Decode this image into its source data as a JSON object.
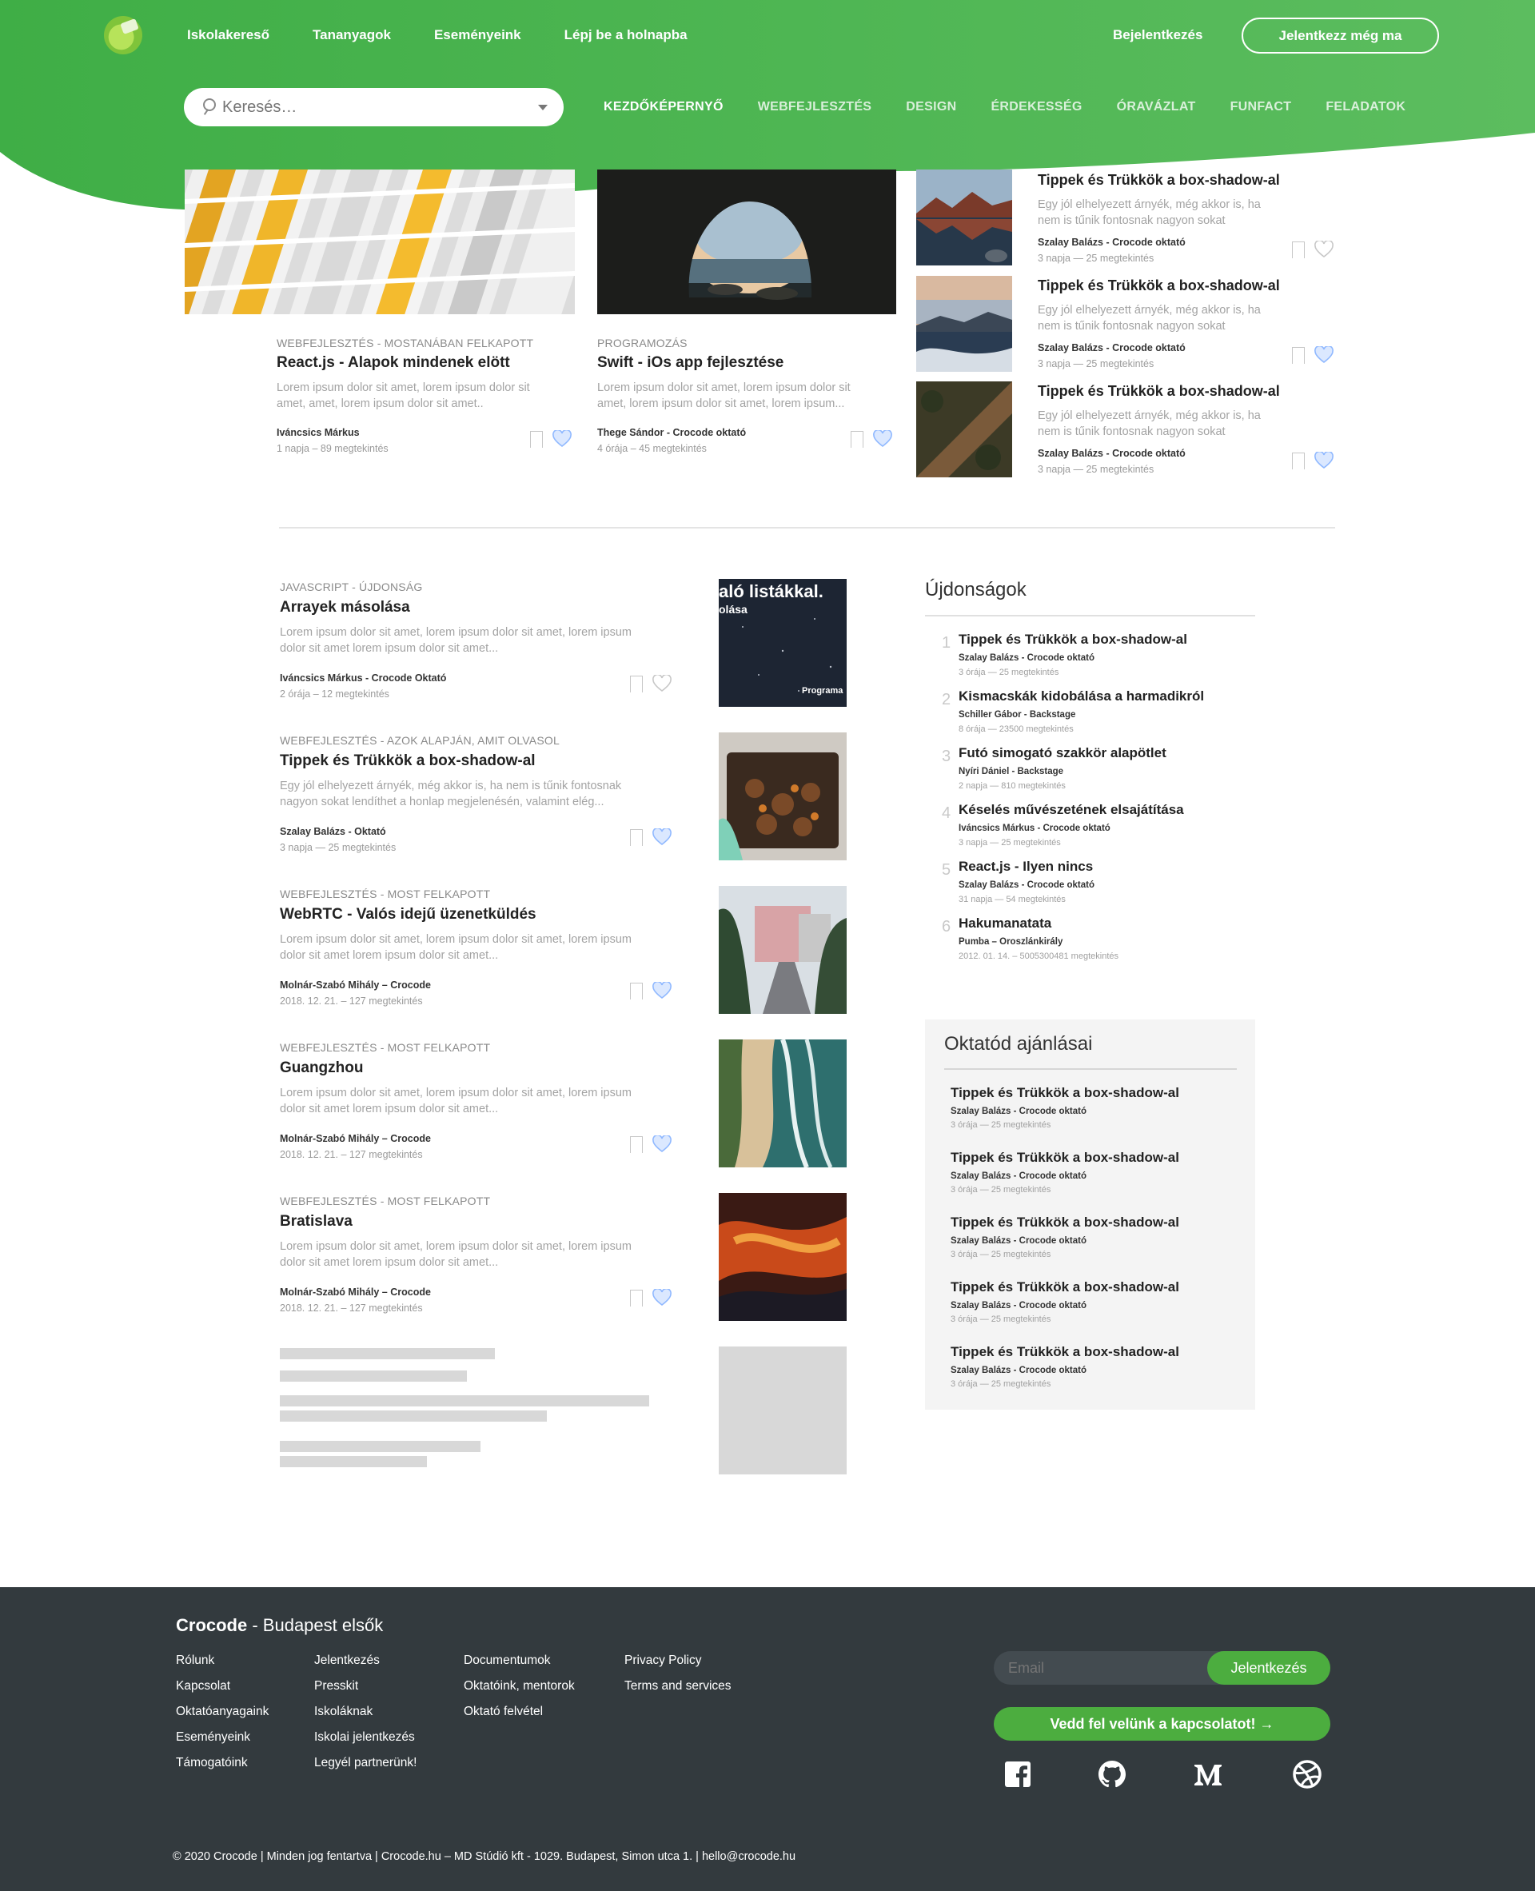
{
  "header": {
    "nav": [
      "Iskolakereső",
      "Tananyagok",
      "Eseményeink",
      "Lépj be a holnapba"
    ],
    "login": "Bejelentkezés",
    "signup": "Jelentkezz még ma",
    "search_placeholder": "Keresés…",
    "categories": [
      "KEZDŐKÉPERNYŐ",
      "WEBFEJLESZTÉS",
      "DESIGN",
      "ÉRDEKESSÉG",
      "ÓRAVÁZLAT",
      "FUNFACT",
      "FELADATOK"
    ],
    "active_category": "KEZDŐKÉPERNYŐ"
  },
  "featured": [
    {
      "category": "WEBFEJLESZTÉS - MOSTANÁBAN FELKAPOTT",
      "title": "React.js - Alapok mindenek elött",
      "excerpt": "Lorem ipsum dolor sit amet,  lorem ipsum dolor sit amet, amet,  lorem ipsum dolor sit amet..",
      "author": "Iváncsics Márkus",
      "stats": "1 napja – 89 megtekintés",
      "liked": true
    },
    {
      "category": "PROGRAMOZÁS",
      "title": "Swift - iOs app fejlesztése",
      "excerpt": "Lorem ipsum dolor sit amet, lorem ipsum dolor sit amet,  lorem ipsum dolor sit amet,  lorem ipsum...",
      "author": "Thege Sándor - Crocode oktató",
      "stats": "4 órája – 45 megtekintés",
      "liked": true
    }
  ],
  "side_featured": [
    {
      "title": "Tippek és Trükkök a box-shadow-al",
      "excerpt": "Egy jól elhelyezett árnyék, még akkor is, ha nem is tűnik fontosnak nagyon sokat",
      "author": "Szalay Balázs - Crocode oktató",
      "stats": "3 napja — 25 megtekintés",
      "liked": false
    },
    {
      "title": "Tippek és Trükkök a box-shadow-al",
      "excerpt": "Egy jól elhelyezett árnyék, még akkor is, ha nem is tűnik fontosnak nagyon sokat",
      "author": "Szalay Balázs - Crocode oktató",
      "stats": "3 napja — 25 megtekintés",
      "liked": true
    },
    {
      "title": "Tippek és Trükkök a box-shadow-al",
      "excerpt": "Egy jól elhelyezett árnyék, még akkor is, ha nem is tűnik fontosnak nagyon sokat",
      "author": "Szalay Balázs - Crocode oktató",
      "stats": "3 napja — 25 megtekintés",
      "liked": true
    }
  ],
  "articles": [
    {
      "category": "JAVASCRIPT - ÚJDONSÁG",
      "title": "Arrayek másolása",
      "excerpt": "Lorem ipsum dolor sit amet, lorem ipsum dolor sit amet, lorem ipsum dolor sit amet lorem ipsum dolor sit amet...",
      "author": "Iváncsics Márkus - Crocode Oktató",
      "stats": "2 órája – 12 megtekintés",
      "thumb_text": "aló listákkal.",
      "thumb_text2": "olása",
      "thumb_text3": "Programa",
      "liked": false
    },
    {
      "category": "WEBFEJLESZTÉS - AZOK ALAPJÁN, AMIT OLVASOL",
      "title": "Tippek és Trükkök a box-shadow-al",
      "excerpt": "Egy jól elhelyezett árnyék, még akkor is, ha nem is tűnik fontosnak nagyon sokat lendíthet a honlap megjelenésén, valamint elég...",
      "author": "Szalay Balázs - Oktató",
      "stats": "3 napja — 25 megtekintés",
      "liked": true
    },
    {
      "category": "WEBFEJLESZTÉS - MOST FELKAPOTT",
      "title": "WebRTC - Valós idejű üzenetküldés",
      "excerpt": "Lorem ipsum dolor sit amet, lorem ipsum dolor sit amet, lorem ipsum dolor sit amet lorem ipsum dolor sit amet...",
      "author": "Molnár-Szabó Mihály – Crocode",
      "stats": "2018. 12. 21. – 127 megtekintés",
      "liked": true
    },
    {
      "category": "WEBFEJLESZTÉS - MOST FELKAPOTT",
      "title": "Guangzhou",
      "excerpt": "Lorem ipsum dolor sit amet, lorem ipsum dolor sit amet, lorem ipsum dolor sit amet lorem ipsum dolor sit amet...",
      "author": "Molnár-Szabó Mihály – Crocode",
      "stats": "2018. 12. 21. – 127 megtekintés",
      "liked": true
    },
    {
      "category": "WEBFEJLESZTÉS - MOST FELKAPOTT",
      "title": "Bratislava",
      "excerpt": "Lorem ipsum dolor sit amet, lorem ipsum dolor sit amet, lorem ipsum dolor sit amet lorem ipsum dolor sit amet...",
      "author": "Molnár-Szabó Mihály – Crocode",
      "stats": "2018. 12. 21. – 127 megtekintés",
      "liked": true
    }
  ],
  "news": {
    "heading": "Újdonságok",
    "items": [
      {
        "num": "1",
        "title": "Tippek és Trükkök a box-shadow-al",
        "author": "Szalay Balázs - Crocode oktató",
        "stats": "3 órája — 25 megtekintés"
      },
      {
        "num": "2",
        "title": "Kismacskák kidobálása a harmadikról",
        "author": "Schiller Gábor - Backstage",
        "stats": "8 órája — 23500 megtekintés"
      },
      {
        "num": "3",
        "title": "Futó simogató szakkör alapötlet",
        "author": "Nyíri Dániel - Backstage",
        "stats": "2 napja — 810 megtekintés"
      },
      {
        "num": "4",
        "title": "Késelés művészetének elsajátítása",
        "author": "Iváncsics Márkus - Crocode oktató",
        "stats": "3 napja — 25 megtekintés"
      },
      {
        "num": "5",
        "title": "React.js - Ilyen nincs",
        "author": "Szalay Balázs - Crocode oktató",
        "stats": "31 napja — 54 megtekintés"
      },
      {
        "num": "6",
        "title": "Hakumanatata",
        "author": "Pumba – Oroszlánkirály",
        "stats": "2012. 01. 14. – 5005300481 megtekintés"
      }
    ]
  },
  "recommendations": {
    "heading": "Oktatód ajánlásai",
    "items": [
      {
        "title": "Tippek és Trükkök a box-shadow-al",
        "author": "Szalay Balázs - Crocode oktató",
        "stats": "3 órája — 25 megtekintés"
      },
      {
        "title": "Tippek és Trükkök a box-shadow-al",
        "author": "Szalay Balázs - Crocode oktató",
        "stats": "3 órája — 25 megtekintés"
      },
      {
        "title": "Tippek és Trükkök a box-shadow-al",
        "author": "Szalay Balázs - Crocode oktató",
        "stats": "3 órája — 25 megtekintés"
      },
      {
        "title": "Tippek és Trükkök a box-shadow-al",
        "author": "Szalay Balázs - Crocode oktató",
        "stats": "3 órája — 25 megtekintés"
      },
      {
        "title": "Tippek és Trükkök a box-shadow-al",
        "author": "Szalay Balázs - Crocode oktató",
        "stats": "3 órája — 25 megtekintés"
      }
    ]
  },
  "footer": {
    "brand_bold": "Crocode",
    "brand_rest": " - Budapest elsők",
    "columns": [
      [
        "Rólunk",
        "Kapcsolat",
        "Oktatóanyagaink",
        "Eseményeink",
        "Támogatóink"
      ],
      [
        "Jelentkezés",
        "Presskit",
        "Iskoláknak",
        "Iskolai jelentkezés",
        "Legyél partnerünk!"
      ],
      [
        "Documentumok",
        "Oktatóink, mentorok",
        "Oktató felvétel"
      ],
      [
        "Privacy Policy",
        "Terms and services"
      ]
    ],
    "email_placeholder": "Email",
    "email_button": "Jelentkezés",
    "contact_button": "Vedd fel velünk a kapcsolatot! →",
    "social": [
      "facebook-icon",
      "github-icon",
      "medium-icon",
      "dribbble-icon"
    ],
    "copyright": "© 2020 Crocode | Minden jog fentartva | Crocode.hu – MD Stúdió kft - 1029. Budapest, Simon utca 1. | hello@crocode.hu"
  },
  "colors": {
    "brand_green": "#4cad3f",
    "header_gradient_start": "#3fae46",
    "header_gradient_end": "#5cbd5f",
    "heart_blue": "#8fb8ff",
    "footer_bg": "#333a3e"
  }
}
